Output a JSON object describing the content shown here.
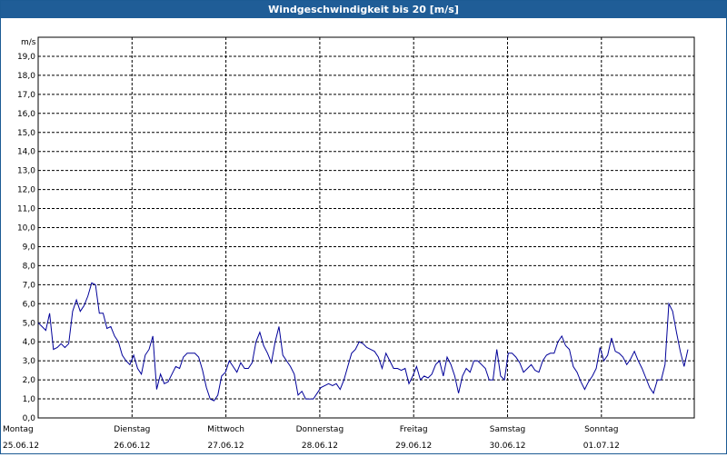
{
  "window": {
    "title": "Windgeschwindigkeit bis 20 [m/s]"
  },
  "chart_data": {
    "type": "line",
    "title": "Windgeschwindigkeit bis 20 [m/s]",
    "ylabel": "m/s",
    "ylim": [
      0,
      20
    ],
    "y_ticks": [
      "0,0",
      "1,0",
      "2,0",
      "3,0",
      "4,0",
      "5,0",
      "6,0",
      "7,0",
      "8,0",
      "9,0",
      "10,0",
      "11,0",
      "12,0",
      "13,0",
      "14,0",
      "15,0",
      "16,0",
      "17,0",
      "18,0",
      "19,0"
    ],
    "x_days": [
      {
        "day": "Montag",
        "date": "25.06.12"
      },
      {
        "day": "Dienstag",
        "date": "26.06.12"
      },
      {
        "day": "Mittwoch",
        "date": "27.06.12"
      },
      {
        "day": "Donnerstag",
        "date": "28.06.12"
      },
      {
        "day": "Freitag",
        "date": "29.06.12"
      },
      {
        "day": "Samstag",
        "date": "30.06.12"
      },
      {
        "day": "Sonntag",
        "date": "01.07.12"
      }
    ],
    "grid": true,
    "line_color": "#000099",
    "series": [
      {
        "values": [
          5.0,
          4.8,
          4.6,
          5.5,
          3.6,
          3.7,
          3.9,
          3.7,
          3.9,
          5.6,
          6.2,
          5.6,
          5.9,
          6.4,
          7.1,
          7.0,
          5.5,
          5.5,
          4.7,
          4.8,
          4.3,
          4.0,
          3.3,
          3.0,
          2.8,
          3.3,
          2.6,
          2.3,
          3.3,
          3.6,
          4.3,
          1.5,
          2.3,
          1.8,
          1.9,
          2.3,
          2.7,
          2.6,
          3.2,
          3.4,
          3.4,
          3.4,
          3.2,
          2.5,
          1.6,
          1.0,
          0.9,
          1.2,
          2.2,
          2.4,
          3.0,
          2.7,
          2.4,
          2.9,
          2.6,
          2.6,
          2.9,
          4.0,
          4.5,
          3.8,
          3.4,
          2.9,
          4.0,
          4.8,
          3.3,
          3.0,
          2.7,
          2.3,
          1.2,
          1.4,
          1.0,
          1.0,
          1.0,
          1.3,
          1.6,
          1.7,
          1.8,
          1.7,
          1.8,
          1.5,
          2.0,
          2.7,
          3.4,
          3.6,
          4.0,
          3.9,
          3.7,
          3.6,
          3.5,
          3.2,
          2.6,
          3.4,
          3.0,
          2.6,
          2.6,
          2.5,
          2.6,
          1.8,
          2.2,
          2.7,
          2.0,
          2.2,
          2.1,
          2.3,
          2.8,
          3.0,
          2.2,
          3.2,
          2.8,
          2.2,
          1.3,
          2.2,
          2.6,
          2.4,
          3.0,
          3.0,
          2.8,
          2.6,
          2.0,
          2.0,
          3.6,
          2.2,
          2.0,
          3.4,
          3.4,
          3.2,
          2.9,
          2.4,
          2.6,
          2.8,
          2.5,
          2.4,
          3.0,
          3.3,
          3.4,
          3.4,
          4.0,
          4.3,
          3.8,
          3.6,
          2.7,
          2.4,
          1.9,
          1.5,
          1.9,
          2.2,
          2.6,
          3.7,
          3.0,
          3.3,
          4.2,
          3.5,
          3.4,
          3.2,
          2.8,
          3.1,
          3.5,
          3.0,
          2.6,
          2.1,
          1.6,
          1.3,
          2.0,
          2.0,
          2.8,
          6.0,
          5.6,
          4.5,
          3.5,
          2.7,
          3.6
        ]
      }
    ]
  }
}
